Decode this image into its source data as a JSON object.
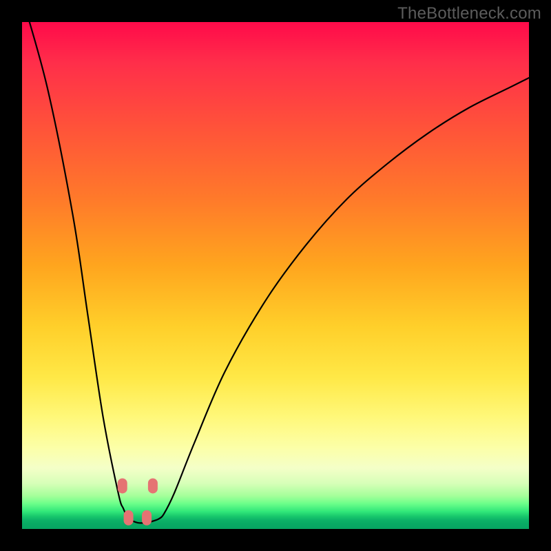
{
  "branding": {
    "text": "TheBottleneck.com"
  },
  "chart_data": {
    "type": "line",
    "title": "",
    "xlabel": "",
    "ylabel": "",
    "xlim": [
      0,
      100
    ],
    "ylim": [
      0,
      100
    ],
    "x": [
      0,
      5,
      10,
      13,
      16,
      19,
      20,
      21,
      22,
      23,
      24,
      25,
      26,
      27,
      28,
      30,
      34,
      40,
      48,
      56,
      64,
      72,
      80,
      88,
      96,
      100
    ],
    "values": [
      105,
      87,
      62,
      42,
      22,
      7,
      4,
      2,
      1.5,
      1.2,
      1.2,
      1.3,
      1.6,
      2,
      3,
      7,
      17,
      31,
      45,
      56,
      65,
      72,
      78,
      83,
      87,
      89
    ],
    "markers": {
      "x": [
        19.8,
        21.0,
        24.6,
        25.8
      ],
      "y": [
        8.5,
        2.2,
        2.2,
        8.5
      ],
      "color": "#e57373",
      "shape": "rounded-rect"
    },
    "background_gradient": "red→orange→yellow→green (vertical)",
    "annotations": []
  }
}
